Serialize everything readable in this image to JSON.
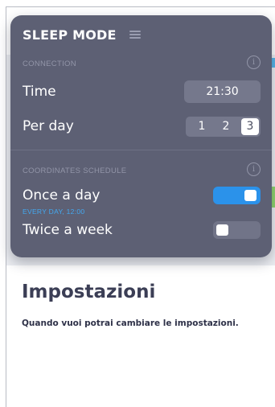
{
  "panel": {
    "title": "SLEEP MODE",
    "menu_icon": "hamburger-menu-icon",
    "connection": {
      "section_label": "CONNECTION",
      "info_icon": "info-icon",
      "info_glyph": "i",
      "time_label": "Time",
      "time_value": "21:30",
      "per_day_label": "Per day",
      "per_day_options": [
        "1",
        "2",
        "3"
      ],
      "per_day_selected": "3"
    },
    "schedule": {
      "section_label": "COORDINATES SCHEDULE",
      "info_icon": "info-icon",
      "info_glyph": "i",
      "once_label": "Once a day",
      "once_sublabel": "EVERY DAY, 12:00",
      "once_enabled": true,
      "twice_label": "Twice a week",
      "twice_enabled": false
    },
    "colors": {
      "panel_bg": "#5d6074",
      "accent": "#2b92ea",
      "sublabel": "#43a8f0"
    }
  },
  "content": {
    "title": "Impostazioni",
    "text": "Quando vuoi potrai cambiare le impostazioni."
  }
}
